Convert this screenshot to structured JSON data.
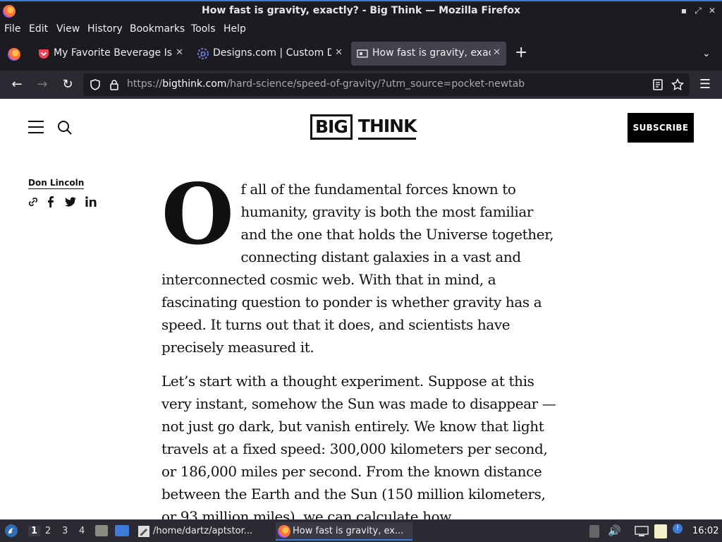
{
  "window": {
    "title": "How fast is gravity, exactly? - Big Think — Mozilla Firefox",
    "minimize": "▪",
    "maximize": "⤢",
    "close": "✕"
  },
  "menu": [
    "File",
    "Edit",
    "View",
    "History",
    "Bookmarks",
    "Tools",
    "Help"
  ],
  "tabs": [
    {
      "label": "My Favorite Beverage Is",
      "icon": "pocket-icon"
    },
    {
      "label": "Designs.com | Custom Do",
      "icon": "designs-icon"
    },
    {
      "label": "How fast is gravity, exactly?",
      "icon": "bigthink-icon",
      "active": true
    }
  ],
  "new_tab": "+",
  "nav": {
    "url_prefix": "https://",
    "url_domain": "bigthink.com",
    "url_path": "/hard-science/speed-of-gravity/?utm_source=pocket-newtab"
  },
  "site": {
    "logo_big": "BIG",
    "logo_think": "THINK",
    "subscribe": "SUBSCRIBE",
    "author": "Don Lincoln"
  },
  "article": {
    "dropcap": "O",
    "p1": "f all of the fundamental forces known to humanity, gravity is both the most familiar and the one that holds the Universe together, connecting distant galaxies in a vast and interconnected cosmic web. With that in mind, a fascinating question to ponder is whether gravity has a speed. It turns out that it does, and scientists have precisely measured it.",
    "p2": "Let’s start with a thought experiment. Suppose at this very instant, somehow the Sun was made to disappear — not just go dark, but vanish entirely. We know that light travels at a fixed speed: 300,000 kilometers per second, or 186,000 miles per second.  From the known distance between the Earth and the Sun (150 million kilometers, or 93 million miles), we can calculate how"
  },
  "taskbar": {
    "workspaces": [
      "1",
      "2",
      "3",
      "4"
    ],
    "tasks": [
      {
        "label": "/home/dartz/aptstor...",
        "icon": "text-editor-icon"
      },
      {
        "label": "How fast is gravity, ex...",
        "icon": "firefox-icon"
      }
    ],
    "clock": "16:02"
  }
}
